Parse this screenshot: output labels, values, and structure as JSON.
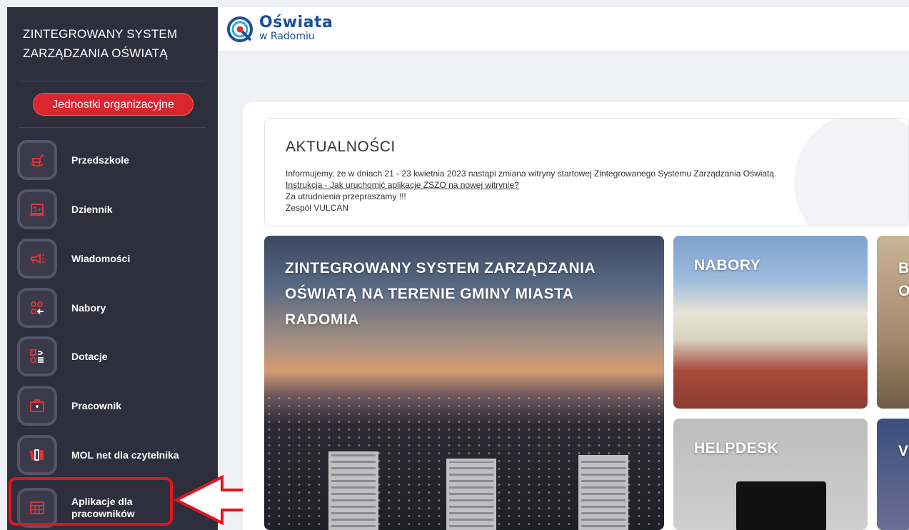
{
  "sidebar": {
    "title_line1": "ZINTEGROWANY SYSTEM",
    "title_line2": "ZARZĄDZANIA OŚWIATĄ",
    "org_button": "Jednostki organizacyjne",
    "items": [
      {
        "label": "Przedszkole",
        "icon": "rocking-horse-icon"
      },
      {
        "label": "Dziennik",
        "icon": "grade-book-icon"
      },
      {
        "label": "Wiadomości",
        "icon": "megaphone-icon"
      },
      {
        "label": "Nabory",
        "icon": "recruitment-icon"
      },
      {
        "label": "Dotacje",
        "icon": "subsidy-icon"
      },
      {
        "label": "Pracownik",
        "icon": "briefcase-icon"
      },
      {
        "label": "MOL net dla czytelnika",
        "icon": "books-icon"
      },
      {
        "label_line1": "Aplikacje dla",
        "label_line2": "pracowników",
        "icon": "grid-table-icon"
      }
    ]
  },
  "header": {
    "logo_line1": "Oświata",
    "logo_line2": "w Radomiu"
  },
  "news": {
    "title": "AKTUALNOŚCI",
    "line1": "Informujemy, że w dniach 21 - 23 kwietnia 2023 nastąpi zmiana witryny startowej Zintegrowanego Systemu Zarządzania Oświatą.",
    "link": "Instrukcja - Jak uruchomić aplikacje ZSZO na nowej witrynie?",
    "line3": "Za utrudnienia przepraszamy !!!",
    "line4": "Zespół VULCAN"
  },
  "tiles": {
    "big": "ZINTEGROWANY SYSTEM ZARZĄDZANIA OŚWIATĄ NA TERENIE GMINY MIASTA RADOMIA",
    "nabory": "NABORY",
    "helpdesk": "HELPDESK",
    "b_line1": "B",
    "b_line2": "O",
    "v": "V"
  },
  "colors": {
    "sidebar_bg": "#2e2e3c",
    "accent_red": "#d9262f",
    "highlight_red": "#e3141c",
    "logo_blue": "#1a4f9a"
  }
}
